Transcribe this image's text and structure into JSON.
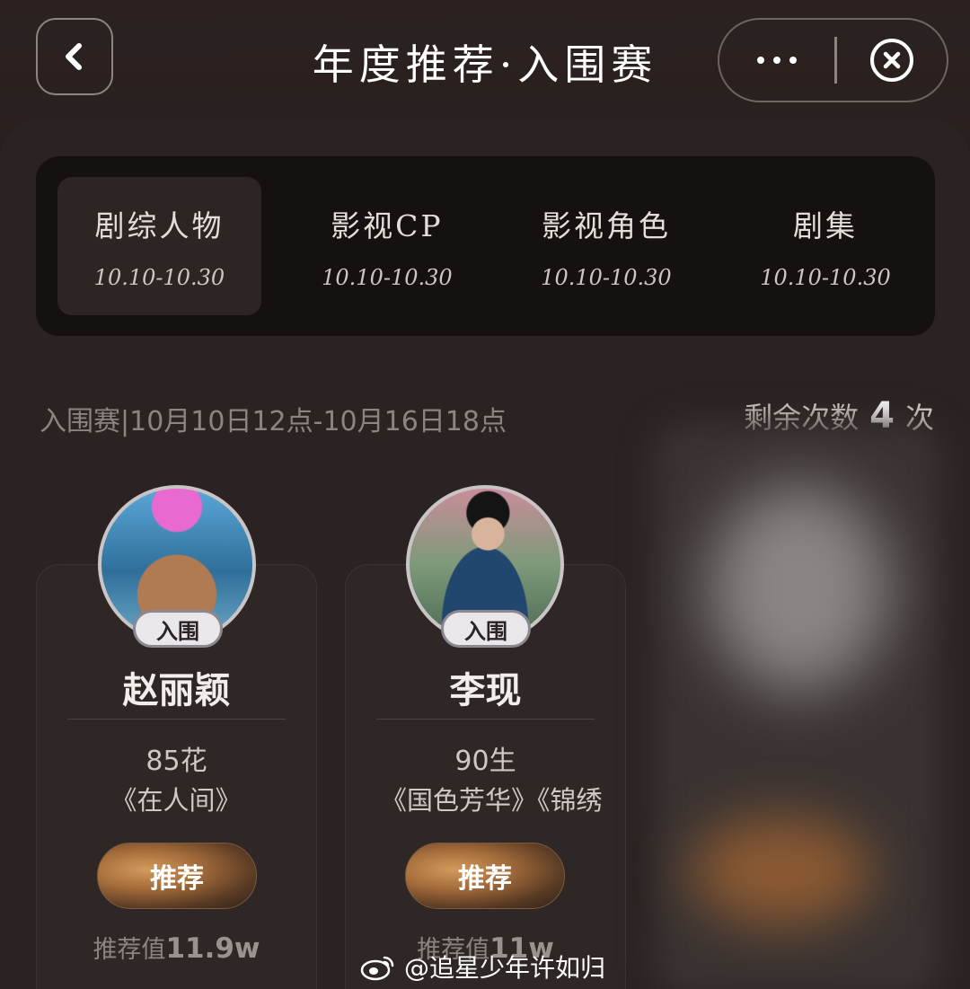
{
  "header": {
    "title": "年度推荐·入围赛",
    "back_icon": "chevron-left-icon",
    "more_icon": "more-horizontal-icon",
    "close_icon": "close-circle-icon"
  },
  "tabs": [
    {
      "label": "剧综人物",
      "date": "10.10-10.30",
      "active": true
    },
    {
      "label": "影视CP",
      "date": "10.10-10.30",
      "active": false
    },
    {
      "label": "影视角色",
      "date": "10.10-10.30",
      "active": false
    },
    {
      "label": "剧集",
      "date": "10.10-10.30",
      "active": false
    }
  ],
  "round_info": "入围赛|10月10日12点-10月16日18点",
  "remaining": {
    "label": "剩余次数",
    "count": "4",
    "unit": "次"
  },
  "cards": [
    {
      "badge": "入围",
      "name": "赵丽颖",
      "tag": "85花",
      "works": "《在人间》",
      "button": "推荐",
      "rec_label": "推荐值",
      "rec_value": "11.9w"
    },
    {
      "badge": "入围",
      "name": "李现",
      "tag": "90生",
      "works": "《国色芳华》《锦绣",
      "button": "推荐",
      "rec_label": "推荐值",
      "rec_value": "11w"
    }
  ],
  "watermark": "@追星少年许如归",
  "colors": {
    "accent_gold": "#a46c3b",
    "background": "#221c1b"
  }
}
